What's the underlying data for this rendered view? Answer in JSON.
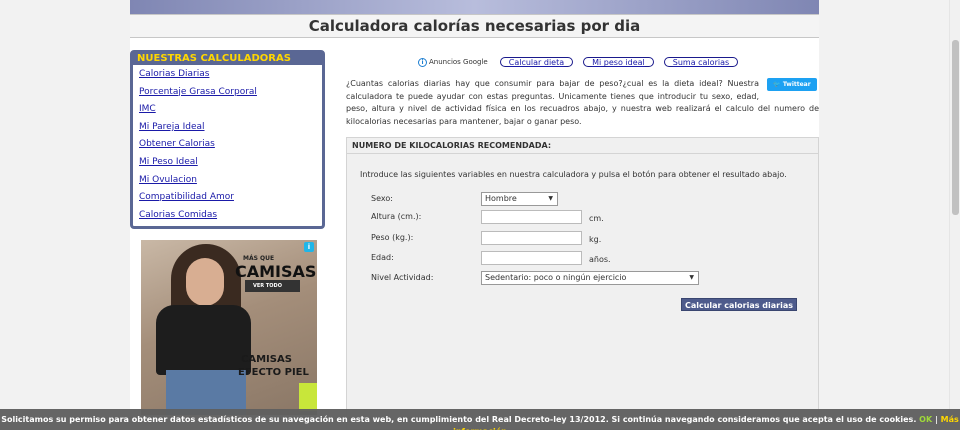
{
  "page": {
    "title": "Calculadora calorías necesarias por dia"
  },
  "sidebar": {
    "header": "NUESTRAS CALCULADORAS",
    "items": [
      "Calorias Diarias",
      "Porcentaje Grasa Corporal",
      "IMC",
      "Mi Pareja Ideal",
      "Obtener Calorias",
      "Mi Peso Ideal",
      "Mi Ovulacion",
      "Compatibilidad Amor",
      "Calorias Comidas"
    ]
  },
  "ad": {
    "small_text": "MÁS QUE",
    "big_text": "CAMISAS",
    "button_text": "VER TODO",
    "bottom_line1": "CAMISAS",
    "bottom_line2": "EFECTO PIEL"
  },
  "google_ads": {
    "label": "Anuncios Google",
    "links": [
      "Calcular dieta",
      "Mi peso ideal",
      "Suma calorias"
    ]
  },
  "intro": {
    "text": "¿Cuantas calorias diarias hay que consumir para bajar de peso?¿cual es la dieta ideal? Nuestra calculadora te puede ayudar con estas preguntas. Unicamente tienes que introducir tu sexo, edad, peso, altura y nivel de actividad física en los recuadros abajo, y nuestra web realizará el calculo del numero de kilocalorias necesarias para mantener, bajar o ganar peso.",
    "twitter_label": "Twittear"
  },
  "form": {
    "header": "NUMERO DE KILOCALORIAS RECOMENDADA:",
    "instructions": "Introduce las siguientes variables en nuestra calculadora y pulsa el botón para obtener el resultado abajo.",
    "sexo_label": "Sexo:",
    "sexo_value": "Hombre",
    "altura_label": "Altura (cm.):",
    "altura_unit": "cm.",
    "peso_label": "Peso (kg.):",
    "peso_unit": "kg.",
    "edad_label": "Edad:",
    "edad_unit": "años.",
    "actividad_label": "Nivel Actividad:",
    "actividad_value": "Sedentario: poco o ningún ejercicio",
    "submit_label": "Calcular calorias diarias"
  },
  "cookie": {
    "text": "Solicitamos su permiso para obtener datos estadísticos de su navegación en esta web, en cumplimiento del Real Decreto-ley 13/2012. Si continúa navegando consideramos que acepta el uso de cookies.",
    "ok": "OK",
    "separator": "|",
    "more": "Más información"
  }
}
